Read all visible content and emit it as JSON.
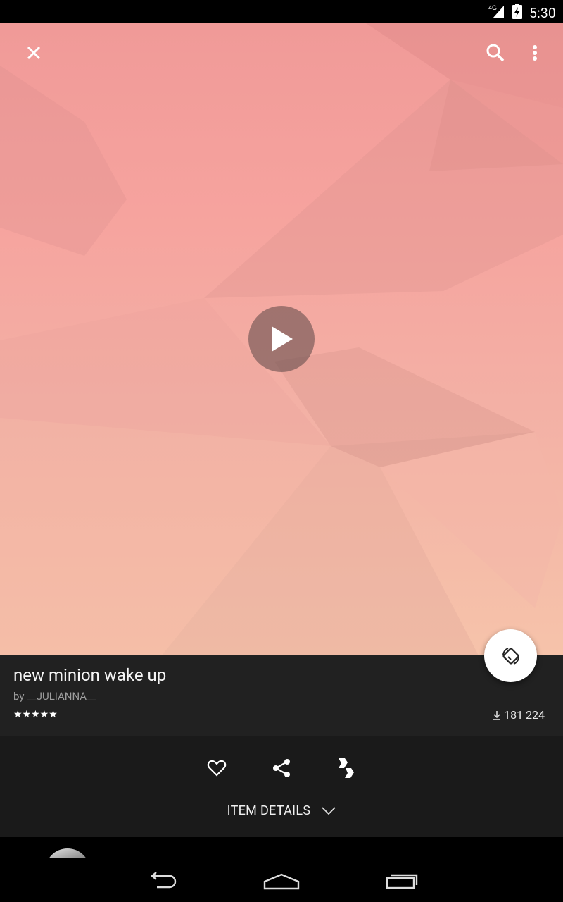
{
  "status_bar": {
    "time": "5:30",
    "network_label": "4G"
  },
  "toolbar": {
    "close_icon": "close-icon",
    "search_icon": "search-icon",
    "menu_icon": "more-vert-icon"
  },
  "item": {
    "title": "new minion wake up",
    "author": "by __JULIANNA__",
    "rating_stars": "★★★★★",
    "downloads": "181 224"
  },
  "actions": [
    "heart-icon",
    "share-icon",
    "remix-icon"
  ],
  "details": {
    "label": "ITEM DETAILS"
  },
  "colors": {
    "panel": "#212121",
    "actions_bg": "#1a1a1a",
    "accent": "#ffffff"
  }
}
